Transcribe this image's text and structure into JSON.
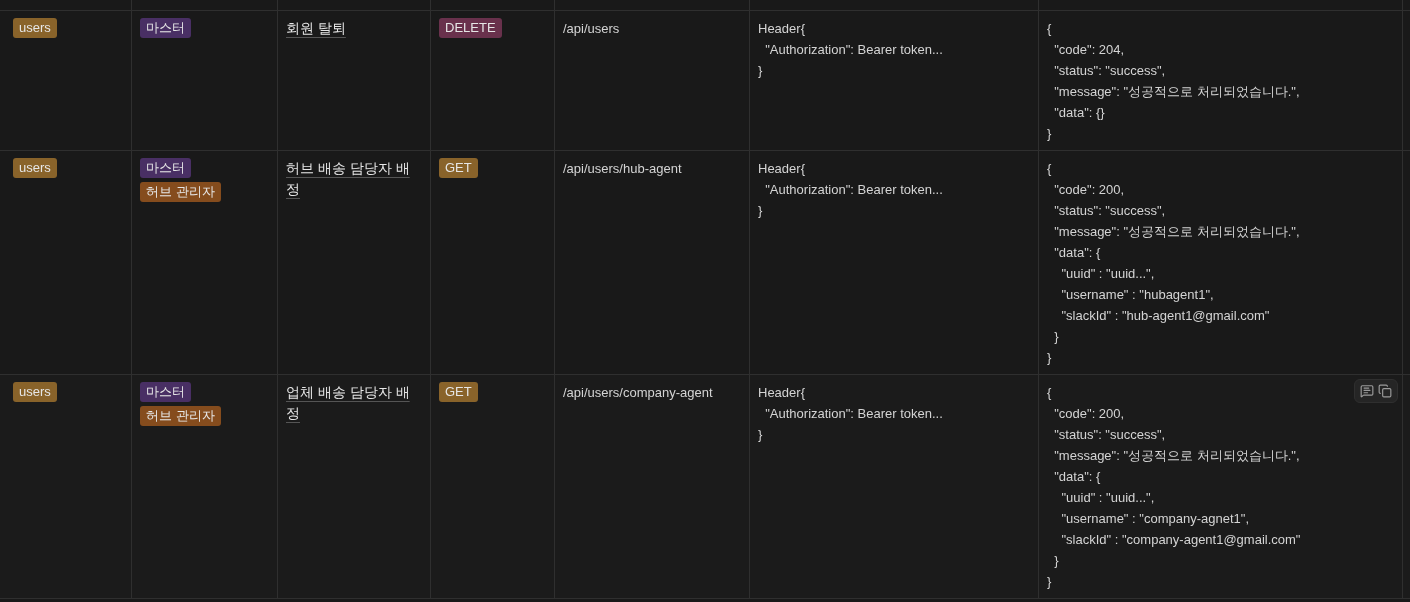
{
  "rows": [
    {
      "domain": [
        {
          "label": "users",
          "color": "#89632a"
        }
      ],
      "roles": [
        {
          "label": "마스터",
          "color": "#492f64"
        }
      ],
      "title": "회원 탈퇴",
      "method": {
        "label": "DELETE",
        "color": "#69314c"
      },
      "path": "/api/users",
      "request": "Header{\n  \"Authorization\": Bearer token...\n}",
      "response": "{\n  \"code\": 204,\n  \"status\": \"success\",\n  \"message\": \"성공적으로 처리되었습니다.\",\n  \"data\": {}\n}",
      "hovered": false
    },
    {
      "domain": [
        {
          "label": "users",
          "color": "#89632a"
        }
      ],
      "roles": [
        {
          "label": "마스터",
          "color": "#492f64"
        },
        {
          "label": "허브 관리자",
          "color": "#854c1d"
        }
      ],
      "title": "허브 배송 담당자 배정",
      "method": {
        "label": "GET",
        "color": "#89632a"
      },
      "path": "/api/users/hub-agent",
      "request": "Header{\n  \"Authorization\": Bearer token...\n}",
      "response": "{\n  \"code\": 200,\n  \"status\": \"success\",\n  \"message\": \"성공적으로 처리되었습니다.\",\n  \"data\": {\n    \"uuid\" : \"uuid...\",\n    \"username\" : \"hubagent1\",\n    \"slackId\" : \"hub-agent1@gmail.com\"\n  }\n}",
      "hovered": false
    },
    {
      "domain": [
        {
          "label": "users",
          "color": "#89632a"
        }
      ],
      "roles": [
        {
          "label": "마스터",
          "color": "#492f64"
        },
        {
          "label": "허브 관리자",
          "color": "#854c1d"
        }
      ],
      "title": "업체 배송 담당자 배정",
      "method": {
        "label": "GET",
        "color": "#89632a"
      },
      "path": "/api/users/company-agent",
      "request": "Header{\n  \"Authorization\": Bearer token...\n}",
      "response": "{\n  \"code\": 200,\n  \"status\": \"success\",\n  \"message\": \"성공적으로 처리되었습니다.\",\n  \"data\": {\n    \"uuid\" : \"uuid...\",\n    \"username\" : \"company-agnet1\",\n    \"slackId\" : \"company-agent1@gmail.com\"\n  }\n}",
      "hovered": true
    }
  ]
}
